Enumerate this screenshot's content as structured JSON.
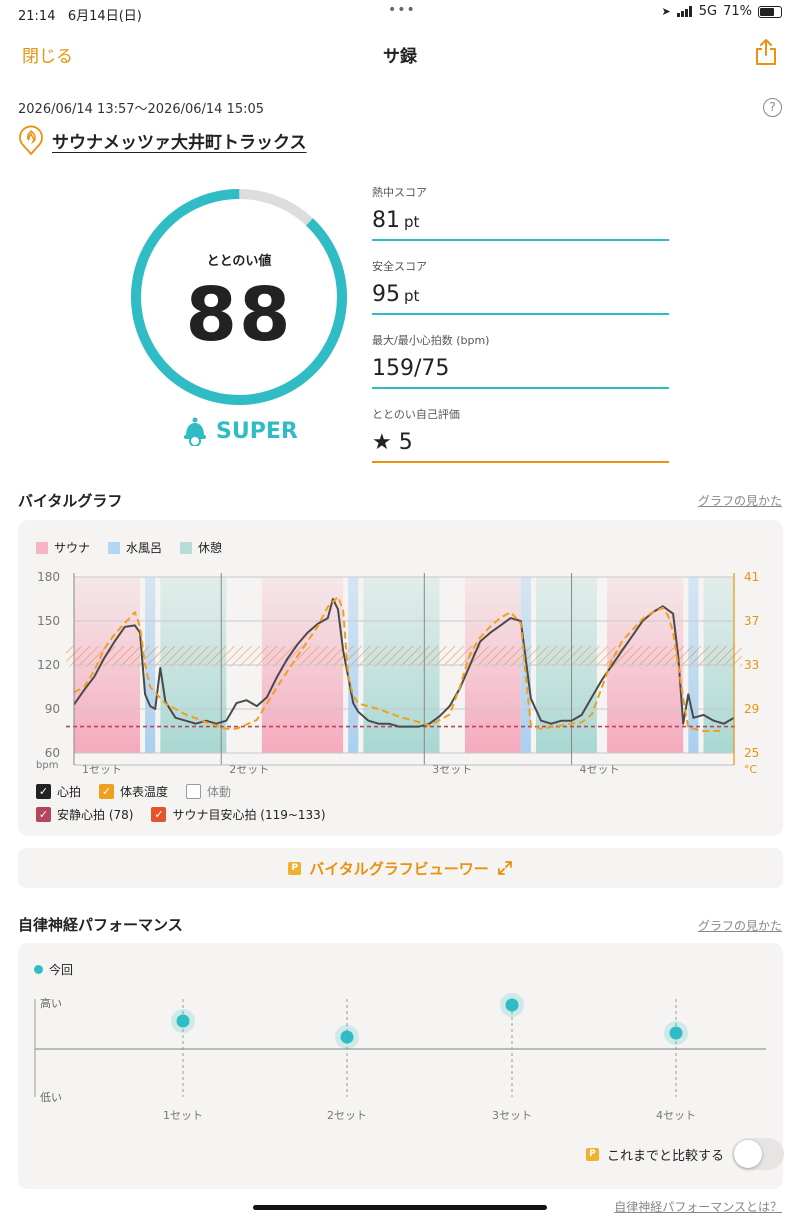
{
  "status_bar": {
    "time": "21:14",
    "date": "6月14日(日)",
    "dots": "•••",
    "network": "5G",
    "battery": "71%",
    "battery_level": 0.71
  },
  "nav": {
    "close": "閉じる",
    "title": "サ録"
  },
  "session": {
    "period": "2026/06/14 13:57～2026/06/14 15:05",
    "facility": "サウナメッツァ大井町トラックス"
  },
  "totonoi": {
    "label": "ととのい値",
    "value": "88",
    "value_fraction": 0.88,
    "rank": "SUPER"
  },
  "scores": [
    {
      "title": "熱中スコア",
      "value": "81",
      "unit": "pt"
    },
    {
      "title": "安全スコア",
      "value": "95",
      "unit": "pt"
    },
    {
      "title": "最大/最小心拍数 (bpm)",
      "value": "159/75",
      "unit": ""
    },
    {
      "title": "ととのい自己評価",
      "value": "★ 5",
      "unit": ""
    }
  ],
  "vital": {
    "title": "バイタルグラフ",
    "howto": "グラフの見かた",
    "legend": [
      "サウナ",
      "水風呂",
      "休憩"
    ],
    "checks": [
      {
        "label": "心拍",
        "checked": true
      },
      {
        "label": "体表温度",
        "checked": true
      },
      {
        "label": "体動",
        "checked": false
      },
      {
        "label": "安静心拍 (78)",
        "checked": true
      },
      {
        "label": "サウナ目安心拍 (119~133)",
        "checked": true
      }
    ],
    "viewer": "バイタルグラフビューワー"
  },
  "autonomic": {
    "title": "自律神経パフォーマンス",
    "howto": "グラフの見かた",
    "legend": "今回",
    "high": "高い",
    "low": "低い",
    "compare": "これまでと比較する",
    "about": "自律神経パフォーマンスとは？"
  },
  "chart_data": [
    {
      "type": "line",
      "ylabel": "bpm",
      "y2label": "°C",
      "ylim": [
        60,
        180
      ],
      "y2lim": [
        25,
        41
      ],
      "yticks": [
        180,
        150,
        120,
        90,
        60
      ],
      "y2ticks": [
        41,
        37,
        33,
        29,
        25
      ],
      "sets": [
        "1セット",
        "2セット",
        "3セット",
        "4セット"
      ],
      "resting_hr": 78,
      "sauna_target_hr": [
        119,
        133
      ],
      "phases": [
        {
          "kind": "sauna",
          "start": 0,
          "end": 13
        },
        {
          "kind": "bath",
          "start": 14,
          "end": 16
        },
        {
          "kind": "rest",
          "start": 17,
          "end": 30
        },
        {
          "kind": "sauna",
          "start": 37,
          "end": 53
        },
        {
          "kind": "bath",
          "start": 54,
          "end": 56
        },
        {
          "kind": "rest",
          "start": 57,
          "end": 72
        },
        {
          "kind": "sauna",
          "start": 77,
          "end": 88
        },
        {
          "kind": "bath",
          "start": 88,
          "end": 90
        },
        {
          "kind": "rest",
          "start": 91,
          "end": 103
        },
        {
          "kind": "sauna",
          "start": 105,
          "end": 120
        },
        {
          "kind": "bath",
          "start": 121,
          "end": 123
        },
        {
          "kind": "rest",
          "start": 124,
          "end": 130
        }
      ],
      "set_starts": [
        0,
        29,
        69,
        98
      ],
      "series": [
        {
          "name": "心拍",
          "points": [
            [
              0,
              93
            ],
            [
              2,
              103
            ],
            [
              4,
              112
            ],
            [
              6,
              125
            ],
            [
              8,
              136
            ],
            [
              10,
              146
            ],
            [
              12,
              147
            ],
            [
              13,
              142
            ],
            [
              14,
              100
            ],
            [
              15,
              92
            ],
            [
              16,
              90
            ],
            [
              17,
              118
            ],
            [
              18,
              95
            ],
            [
              20,
              84
            ],
            [
              22,
              82
            ],
            [
              24,
              80
            ],
            [
              26,
              82
            ],
            [
              28,
              80
            ],
            [
              30,
              82
            ],
            [
              32,
              94
            ],
            [
              34,
              96
            ],
            [
              36,
              92
            ],
            [
              38,
              98
            ],
            [
              40,
              112
            ],
            [
              42,
              124
            ],
            [
              44,
              134
            ],
            [
              46,
              142
            ],
            [
              48,
              148
            ],
            [
              50,
              152
            ],
            [
              51,
              165
            ],
            [
              52,
              158
            ],
            [
              53,
              130
            ],
            [
              54,
              112
            ],
            [
              55,
              94
            ],
            [
              56,
              88
            ],
            [
              58,
              82
            ],
            [
              60,
              80
            ],
            [
              62,
              80
            ],
            [
              64,
              78
            ],
            [
              66,
              78
            ],
            [
              68,
              78
            ],
            [
              70,
              80
            ],
            [
              72,
              85
            ],
            [
              74,
              92
            ],
            [
              76,
              104
            ],
            [
              78,
              120
            ],
            [
              80,
              136
            ],
            [
              82,
              142
            ],
            [
              84,
              147
            ],
            [
              86,
              152
            ],
            [
              88,
              150
            ],
            [
              90,
              97
            ],
            [
              92,
              82
            ],
            [
              94,
              80
            ],
            [
              96,
              82
            ],
            [
              98,
              82
            ],
            [
              100,
              86
            ],
            [
              102,
              98
            ],
            [
              104,
              110
            ],
            [
              106,
              120
            ],
            [
              108,
              130
            ],
            [
              110,
              140
            ],
            [
              112,
              150
            ],
            [
              114,
              156
            ],
            [
              116,
              160
            ],
            [
              118,
              155
            ],
            [
              119,
              126
            ],
            [
              120,
              80
            ],
            [
              121,
              100
            ],
            [
              122,
              84
            ],
            [
              124,
              86
            ],
            [
              126,
              82
            ],
            [
              128,
              80
            ],
            [
              130,
              84
            ]
          ]
        },
        {
          "name": "体表温度",
          "points": [
            [
              0,
              30.5
            ],
            [
              2,
              31
            ],
            [
              4,
              32.5
            ],
            [
              6,
              34.5
            ],
            [
              8,
              35.8
            ],
            [
              10,
              36.8
            ],
            [
              12,
              37.8
            ],
            [
              13,
              36.5
            ],
            [
              14,
              33
            ],
            [
              15,
              31
            ],
            [
              16,
              30.5
            ],
            [
              18,
              29.5
            ],
            [
              22,
              28.5
            ],
            [
              26,
              27.8
            ],
            [
              30,
              27.2
            ],
            [
              32,
              27.2
            ],
            [
              36,
              28
            ],
            [
              40,
              31
            ],
            [
              44,
              33.8
            ],
            [
              48,
              36.5
            ],
            [
              50,
              38.3
            ],
            [
              52,
              39.2
            ],
            [
              53,
              38
            ],
            [
              54,
              32
            ],
            [
              55,
              30.2
            ],
            [
              56,
              29.5
            ],
            [
              60,
              29
            ],
            [
              64,
              28.3
            ],
            [
              68,
              27.8
            ],
            [
              70,
              27.5
            ],
            [
              74,
              28.5
            ],
            [
              76,
              31
            ],
            [
              78,
              34
            ],
            [
              80,
              35.5
            ],
            [
              82,
              36.5
            ],
            [
              84,
              37.3
            ],
            [
              86,
              37.8
            ],
            [
              88,
              36.8
            ],
            [
              89,
              32
            ],
            [
              90,
              27.5
            ],
            [
              92,
              27.2
            ],
            [
              96,
              27.5
            ],
            [
              100,
              27.8
            ],
            [
              102,
              28.5
            ],
            [
              104,
              31
            ],
            [
              106,
              33.5
            ],
            [
              108,
              35.2
            ],
            [
              110,
              36.2
            ],
            [
              112,
              37.2
            ],
            [
              114,
              37.8
            ],
            [
              116,
              38.2
            ],
            [
              117,
              37.5
            ],
            [
              118,
              36
            ],
            [
              119,
              33
            ],
            [
              120,
              30
            ],
            [
              121,
              27.3
            ],
            [
              124,
              27
            ],
            [
              128,
              27
            ]
          ]
        }
      ]
    },
    {
      "type": "scatter",
      "name": "今回",
      "categories": [
        "1セット",
        "2セット",
        "3セット",
        "4セット"
      ],
      "values": [
        0.55,
        0.15,
        0.95,
        0.25
      ],
      "ylabel_high": "高い",
      "ylabel_low": "低い"
    }
  ]
}
